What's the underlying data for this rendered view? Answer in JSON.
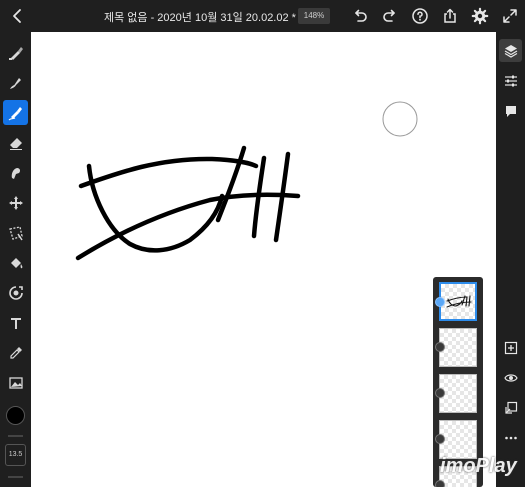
{
  "header": {
    "title": "제목 없음 - 2020년 10월 31일 20.02.02 *",
    "zoom": "148%",
    "icons": [
      "back-icon",
      "chevron-down-icon",
      "undo-icon",
      "redo-icon",
      "help-icon",
      "share-icon",
      "settings-icon",
      "expand-icon"
    ]
  },
  "left_toolbar": {
    "tools": [
      "pixel-brush",
      "live-brush",
      "vector-brush",
      "eraser",
      "smudge",
      "transform",
      "selection",
      "fill",
      "liquify",
      "text",
      "eyedropper",
      "image"
    ],
    "active_tool": "vector-brush",
    "color": "#000000",
    "brush_size": "13.5"
  },
  "right_toolbar": {
    "tools": [
      "layers-icon",
      "adjust-icon",
      "comment-icon",
      "add-layer-icon",
      "visibility-icon",
      "merge-icon",
      "more-icon"
    ],
    "active_tool": "layers-icon"
  },
  "layers": {
    "count": 5,
    "selected_index": 0
  },
  "colors": {
    "accent": "#1473e6",
    "toolbar": "#1f1f1f",
    "canvas": "#ffffff"
  },
  "watermark": "imoPlay"
}
